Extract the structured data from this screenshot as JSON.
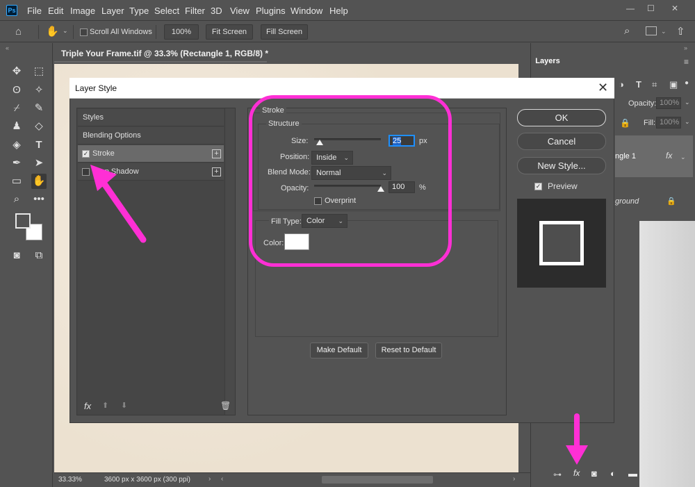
{
  "menubar": {
    "logo": "Ps",
    "items": [
      "File",
      "Edit",
      "Image",
      "Layer",
      "Type",
      "Select",
      "Filter",
      "3D",
      "View",
      "Plugins",
      "Window",
      "Help"
    ],
    "window_controls": [
      "—",
      "☐",
      "✕"
    ]
  },
  "options_bar": {
    "scroll_all_windows": "Scroll All Windows",
    "zoom_100": "100%",
    "fit_screen": "Fit Screen",
    "fill_screen": "Fill Screen"
  },
  "document": {
    "tab_title": "Triple Your Frame.tif @ 33.3% (Rectangle 1, RGB/8) *",
    "tab_close": "×",
    "zoom": "33.33%",
    "doc_info": "3600 px x 3600 px (300 ppi)"
  },
  "layers_panel": {
    "tab": "Layers",
    "opacity_label": "Opacity:",
    "opacity_value": "100%",
    "fill_label": "Fill:",
    "fill_value": "100%",
    "layer_1": "ngle 1",
    "layer_fx": "fx",
    "layer_bg": "ground"
  },
  "dialog": {
    "title": "Layer Style",
    "close": "✕",
    "style_list": {
      "styles": "Styles",
      "blending_options": "Blending Options",
      "stroke": "Stroke",
      "drop_shadow": "Drop Shadow",
      "plus": "+",
      "fx": "fx",
      "trash": "🗑"
    },
    "stroke": {
      "section": "Stroke",
      "structure": "Structure",
      "size_label": "Size:",
      "size_value": "25",
      "size_unit": "px",
      "size_fraction": 0.08,
      "position_label": "Position:",
      "position_value": "Inside",
      "blend_label": "Blend Mode:",
      "blend_value": "Normal",
      "opacity_label": "Opacity:",
      "opacity_value": "100",
      "opacity_unit": "%",
      "opacity_fraction": 1.0,
      "overprint": "Overprint",
      "fill_type_label": "Fill Type:",
      "fill_type_value": "Color",
      "color_label": "Color:",
      "color_value": "#ffffff",
      "make_default": "Make Default",
      "reset_default": "Reset to Default"
    },
    "buttons": {
      "ok": "OK",
      "cancel": "Cancel",
      "new_style": "New Style...",
      "preview": "Preview"
    }
  },
  "colors": {
    "annotation": "#ff2fd5",
    "panel": "#535353",
    "dialog_title": "#ffffff"
  }
}
